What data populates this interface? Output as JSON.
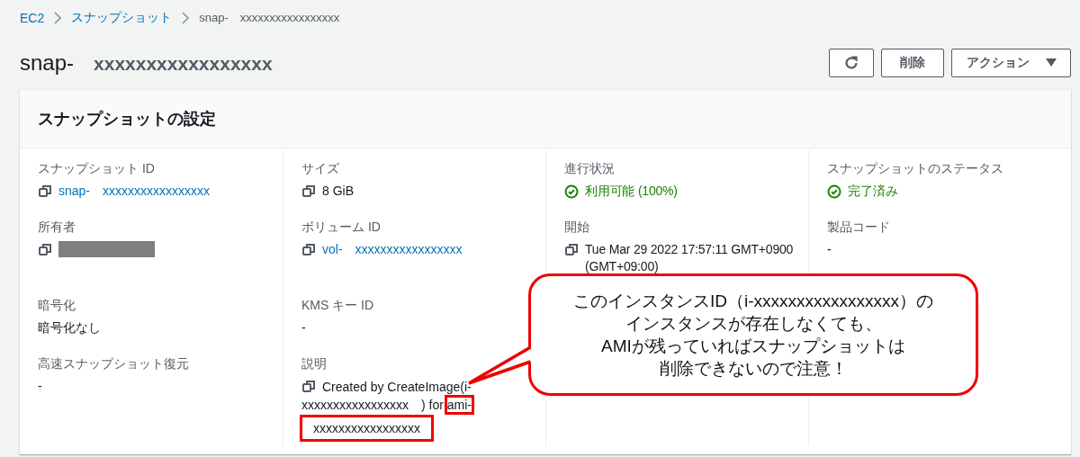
{
  "breadcrumb": [
    {
      "label": "EC2",
      "link": true
    },
    {
      "label": "スナップショット",
      "link": true
    },
    {
      "label": "snap-　xxxxxxxxxxxxxxxxx",
      "link": false
    }
  ],
  "page_title": {
    "prefix": "snap-",
    "id": "xxxxxxxxxxxxxxxxx"
  },
  "buttons": [
    {
      "kind": "refresh"
    },
    {
      "kind": "text",
      "label": "削除"
    },
    {
      "kind": "dropdown",
      "label": "アクション"
    }
  ],
  "panel": {
    "title": "スナップショットの設定",
    "rows": [
      [
        {
          "label": "スナップショット ID",
          "kind": "link",
          "copy": true,
          "value": "snap-　xxxxxxxxxxxxxxxxx"
        },
        {
          "label": "サイズ",
          "kind": "text",
          "copy": true,
          "value": "8 GiB"
        },
        {
          "label": "進行状況",
          "kind": "status",
          "copy": false,
          "value": "利用可能 (100%)"
        },
        {
          "label": "スナップショットのステータス",
          "kind": "status",
          "copy": false,
          "value": "完了済み"
        }
      ],
      [
        {
          "label": "所有者",
          "kind": "redacted",
          "copy": true
        },
        {
          "label": "ボリューム ID",
          "kind": "link",
          "copy": true,
          "value": "vol-　xxxxxxxxxxxxxxxxx"
        },
        {
          "label": "開始",
          "kind": "text",
          "copy": true,
          "value": "Tue Mar 29 2022 17:57:11 GMT+0900 (GMT+09:00)"
        },
        {
          "label": "製品コード",
          "kind": "text",
          "copy": false,
          "value": "-"
        }
      ],
      [
        {
          "label": "暗号化",
          "kind": "text",
          "copy": false,
          "value": "暗号化なし"
        },
        {
          "label": "KMS キー ID",
          "kind": "text",
          "copy": false,
          "value": "-"
        }
      ],
      [
        {
          "label": "高速スナップショット復元",
          "kind": "text",
          "copy": false,
          "value": "-"
        },
        {
          "label": "説明",
          "kind": "segments",
          "copy": true,
          "segments": [
            {
              "text": "Created by CreateImage(i-xxxxxxxxxxxxxxxxx　) for ",
              "highlighted": false
            },
            {
              "text": "ami-",
              "highlighted": true
            },
            {
              "text": "xxxxxxxxxxxxxxxxx",
              "highlighted": true
            }
          ]
        }
      ]
    ]
  },
  "callout": {
    "lines": [
      "このインスタンスID（i-xxxxxxxxxxxxxxxxx）の",
      "インスタンスが存在しなくても、",
      "AMIが残っていればスナップショットは",
      "削除できないので注意！"
    ]
  }
}
